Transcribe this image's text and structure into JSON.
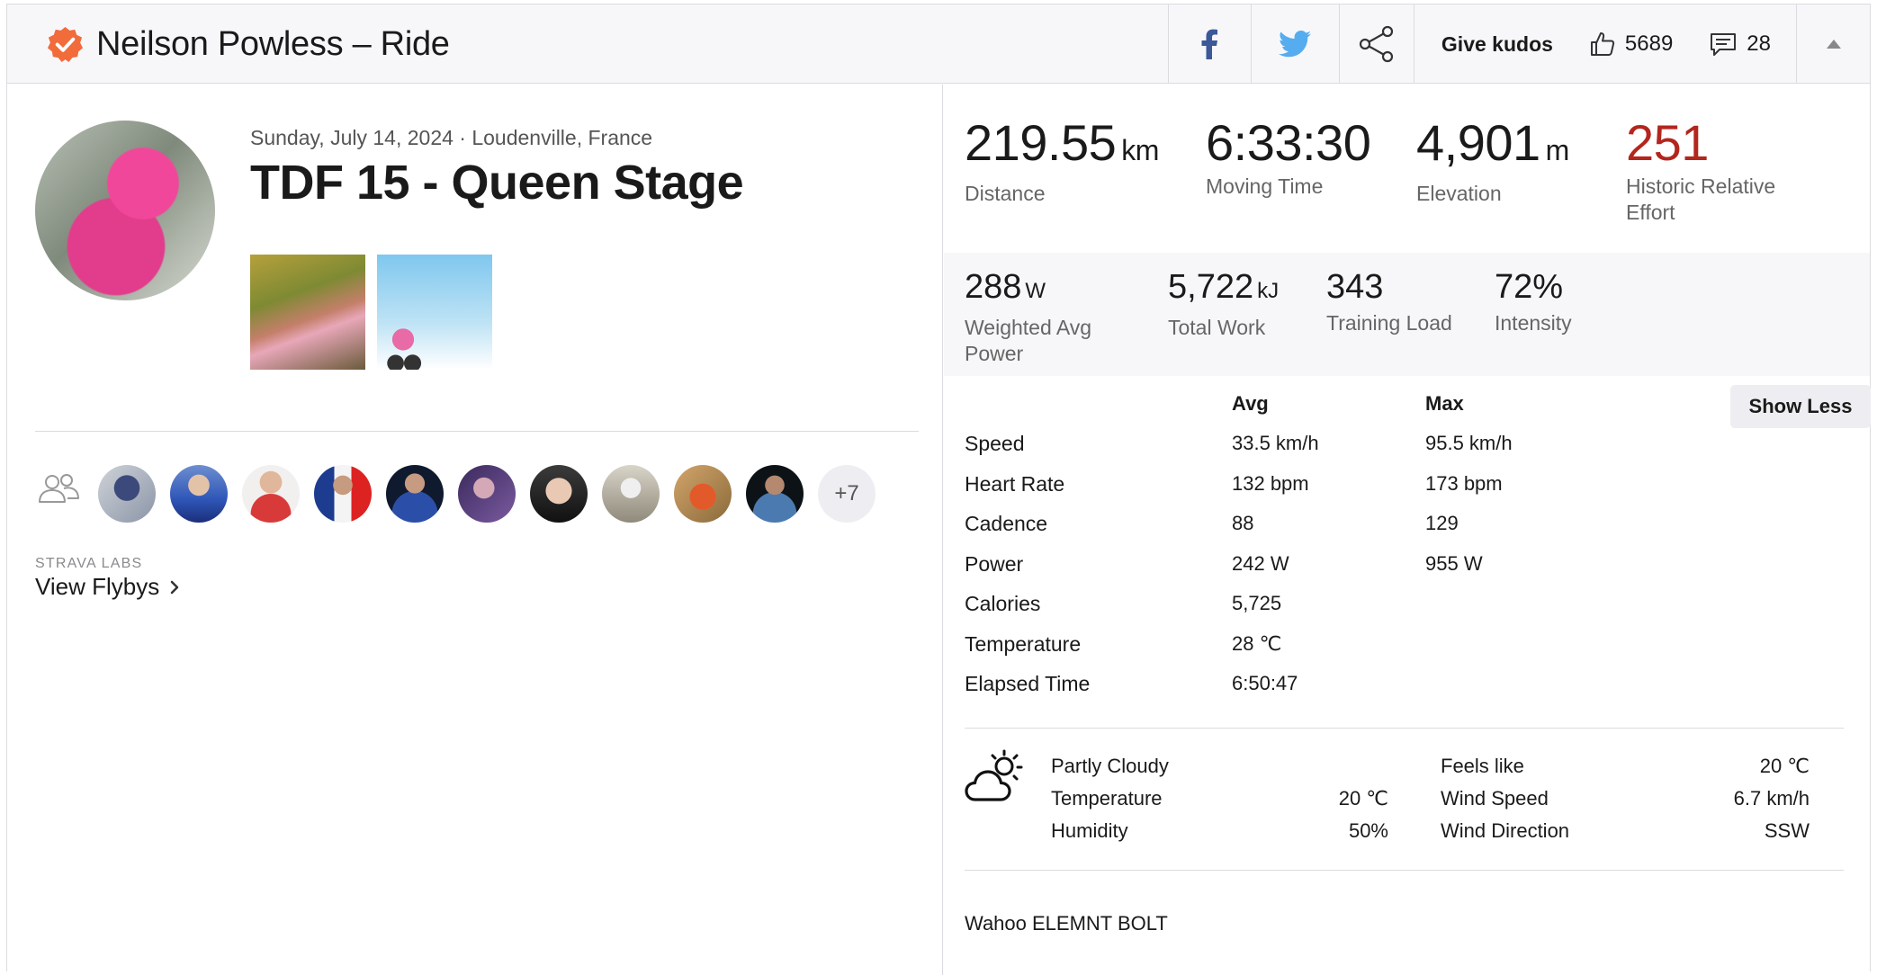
{
  "header": {
    "athlete_name": "Neilson Powless",
    "separator": "–",
    "activity_type": "Ride",
    "give_kudos_label": "Give kudos",
    "kudos_count": "5689",
    "comment_count": "28"
  },
  "activity": {
    "date_location": "Sunday, July 14, 2024 · Loudenville, France",
    "title": "TDF 15 - Queen Stage"
  },
  "group": {
    "more_label": "+7"
  },
  "flybys": {
    "labs_label": "STRAVA LABS",
    "link_label": "View Flybys"
  },
  "primary_stats": [
    {
      "value": "219.55",
      "unit": "km",
      "label": "Distance"
    },
    {
      "value": "6:33:30",
      "unit": "",
      "label": "Moving Time"
    },
    {
      "value": "4,901",
      "unit": "m",
      "label": "Elevation"
    },
    {
      "value": "251",
      "unit": "",
      "label": "Historic Relative Effort"
    }
  ],
  "secondary_stats": [
    {
      "value": "288",
      "unit": "W",
      "label": "Weighted Avg Power"
    },
    {
      "value": "5,722",
      "unit": "kJ",
      "label": "Total Work"
    },
    {
      "value": "343",
      "unit": "",
      "label": "Training Load"
    },
    {
      "value": "72%",
      "unit": "",
      "label": "Intensity"
    }
  ],
  "details": {
    "avg_header": "Avg",
    "max_header": "Max",
    "show_less_label": "Show Less",
    "rows": [
      {
        "label": "Speed",
        "avg": "33.5 km/h",
        "max": "95.5 km/h"
      },
      {
        "label": "Heart Rate",
        "avg": "132 bpm",
        "max": "173 bpm"
      },
      {
        "label": "Cadence",
        "avg": "88",
        "max": "129"
      },
      {
        "label": "Power",
        "avg": "242 W",
        "max": "955 W"
      },
      {
        "label": "Calories",
        "avg": "5,725",
        "max": ""
      },
      {
        "label": "Temperature",
        "avg": "28 ℃",
        "max": ""
      },
      {
        "label": "Elapsed Time",
        "avg": "6:50:47",
        "max": ""
      }
    ]
  },
  "weather": {
    "condition": "Partly Cloudy",
    "temperature_label": "Temperature",
    "temperature_value": "20 ℃",
    "humidity_label": "Humidity",
    "humidity_value": "50%",
    "feels_like_label": "Feels like",
    "feels_like_value": "20 ℃",
    "wind_speed_label": "Wind Speed",
    "wind_speed_value": "6.7 km/h",
    "wind_direction_label": "Wind Direction",
    "wind_direction_value": "SSW"
  },
  "device": "Wahoo ELEMNT BOLT",
  "colors": {
    "brand_orange": "#fc5200",
    "relative_effort_red": "#b3261e",
    "facebook_blue": "#3b5998",
    "twitter_blue": "#55acee"
  }
}
